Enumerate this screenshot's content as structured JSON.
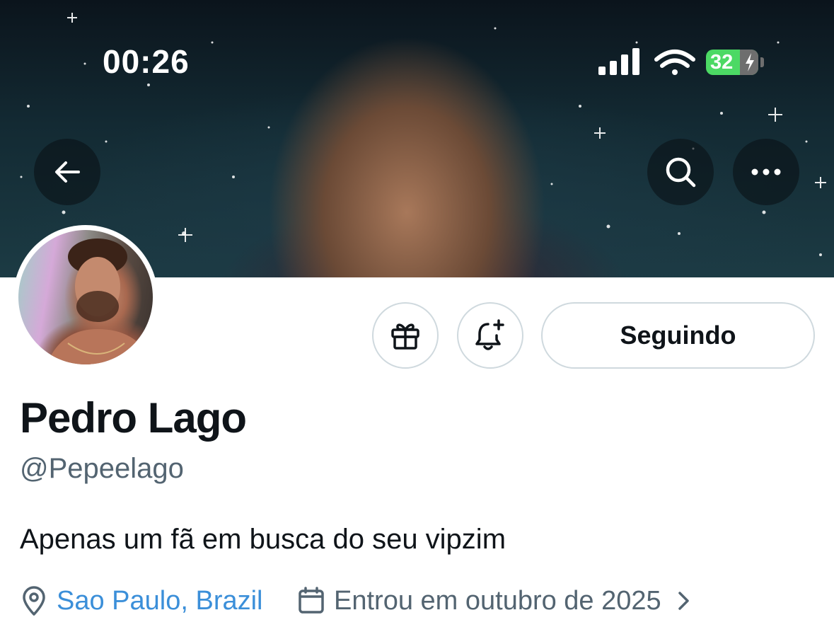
{
  "status_bar": {
    "time": "00:26",
    "battery": "32",
    "battery_color": "#4cd964"
  },
  "header": {
    "back_icon": "arrow-left-icon",
    "search_icon": "search-icon",
    "more_icon": "more-horizontal-icon"
  },
  "profile": {
    "name": "Pedro Lago",
    "handle": "@Pepeelago",
    "bio": "Apenas um fã em busca do seu vipzim",
    "location": "Sao Paulo, Brazil",
    "joined": "Entrou em outubro de 2025"
  },
  "actions": {
    "gift_icon": "gift-icon",
    "notify_icon": "bell-plus-icon",
    "follow_label": "Seguindo"
  },
  "colors": {
    "link": "#1d9bf0",
    "text": "#0f1419",
    "secondary": "#536471",
    "border": "#cfd9de"
  }
}
